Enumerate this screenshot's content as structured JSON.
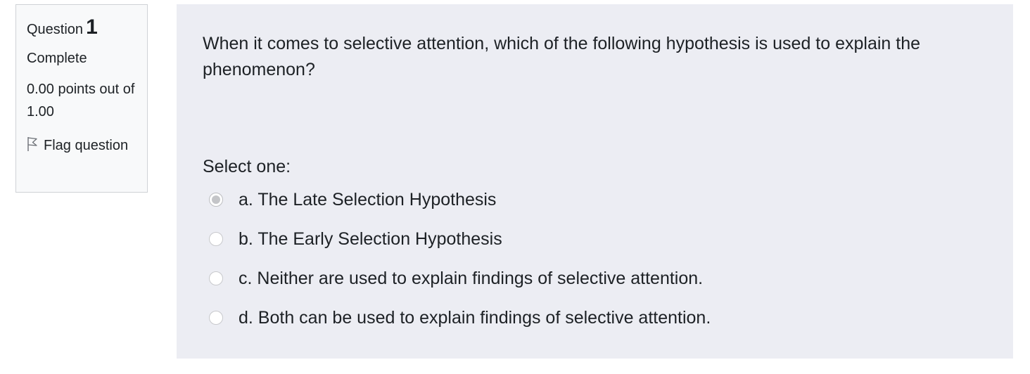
{
  "info": {
    "question_word": "Question",
    "question_number": "1",
    "state": "Complete",
    "grade": "0.00 points out of 1.00",
    "flag_label": "Flag question"
  },
  "question": {
    "text": "When it comes to selective attention, which of the following hypothesis is used to explain the phenomenon?",
    "prompt": "Select one:",
    "options": [
      {
        "label": "a. The Late Selection Hypothesis",
        "selected": true
      },
      {
        "label": "b. The Early Selection Hypothesis",
        "selected": false
      },
      {
        "label": "c. Neither are used to explain findings of selective attention.",
        "selected": false
      },
      {
        "label": "d. Both can be used to explain findings of selective attention.",
        "selected": false
      }
    ]
  },
  "colors": {
    "content_bg": "#ecedf3",
    "info_border": "#cfd2d6",
    "text": "#1d2125"
  },
  "icons": {
    "flag": "flag-outline-icon"
  }
}
